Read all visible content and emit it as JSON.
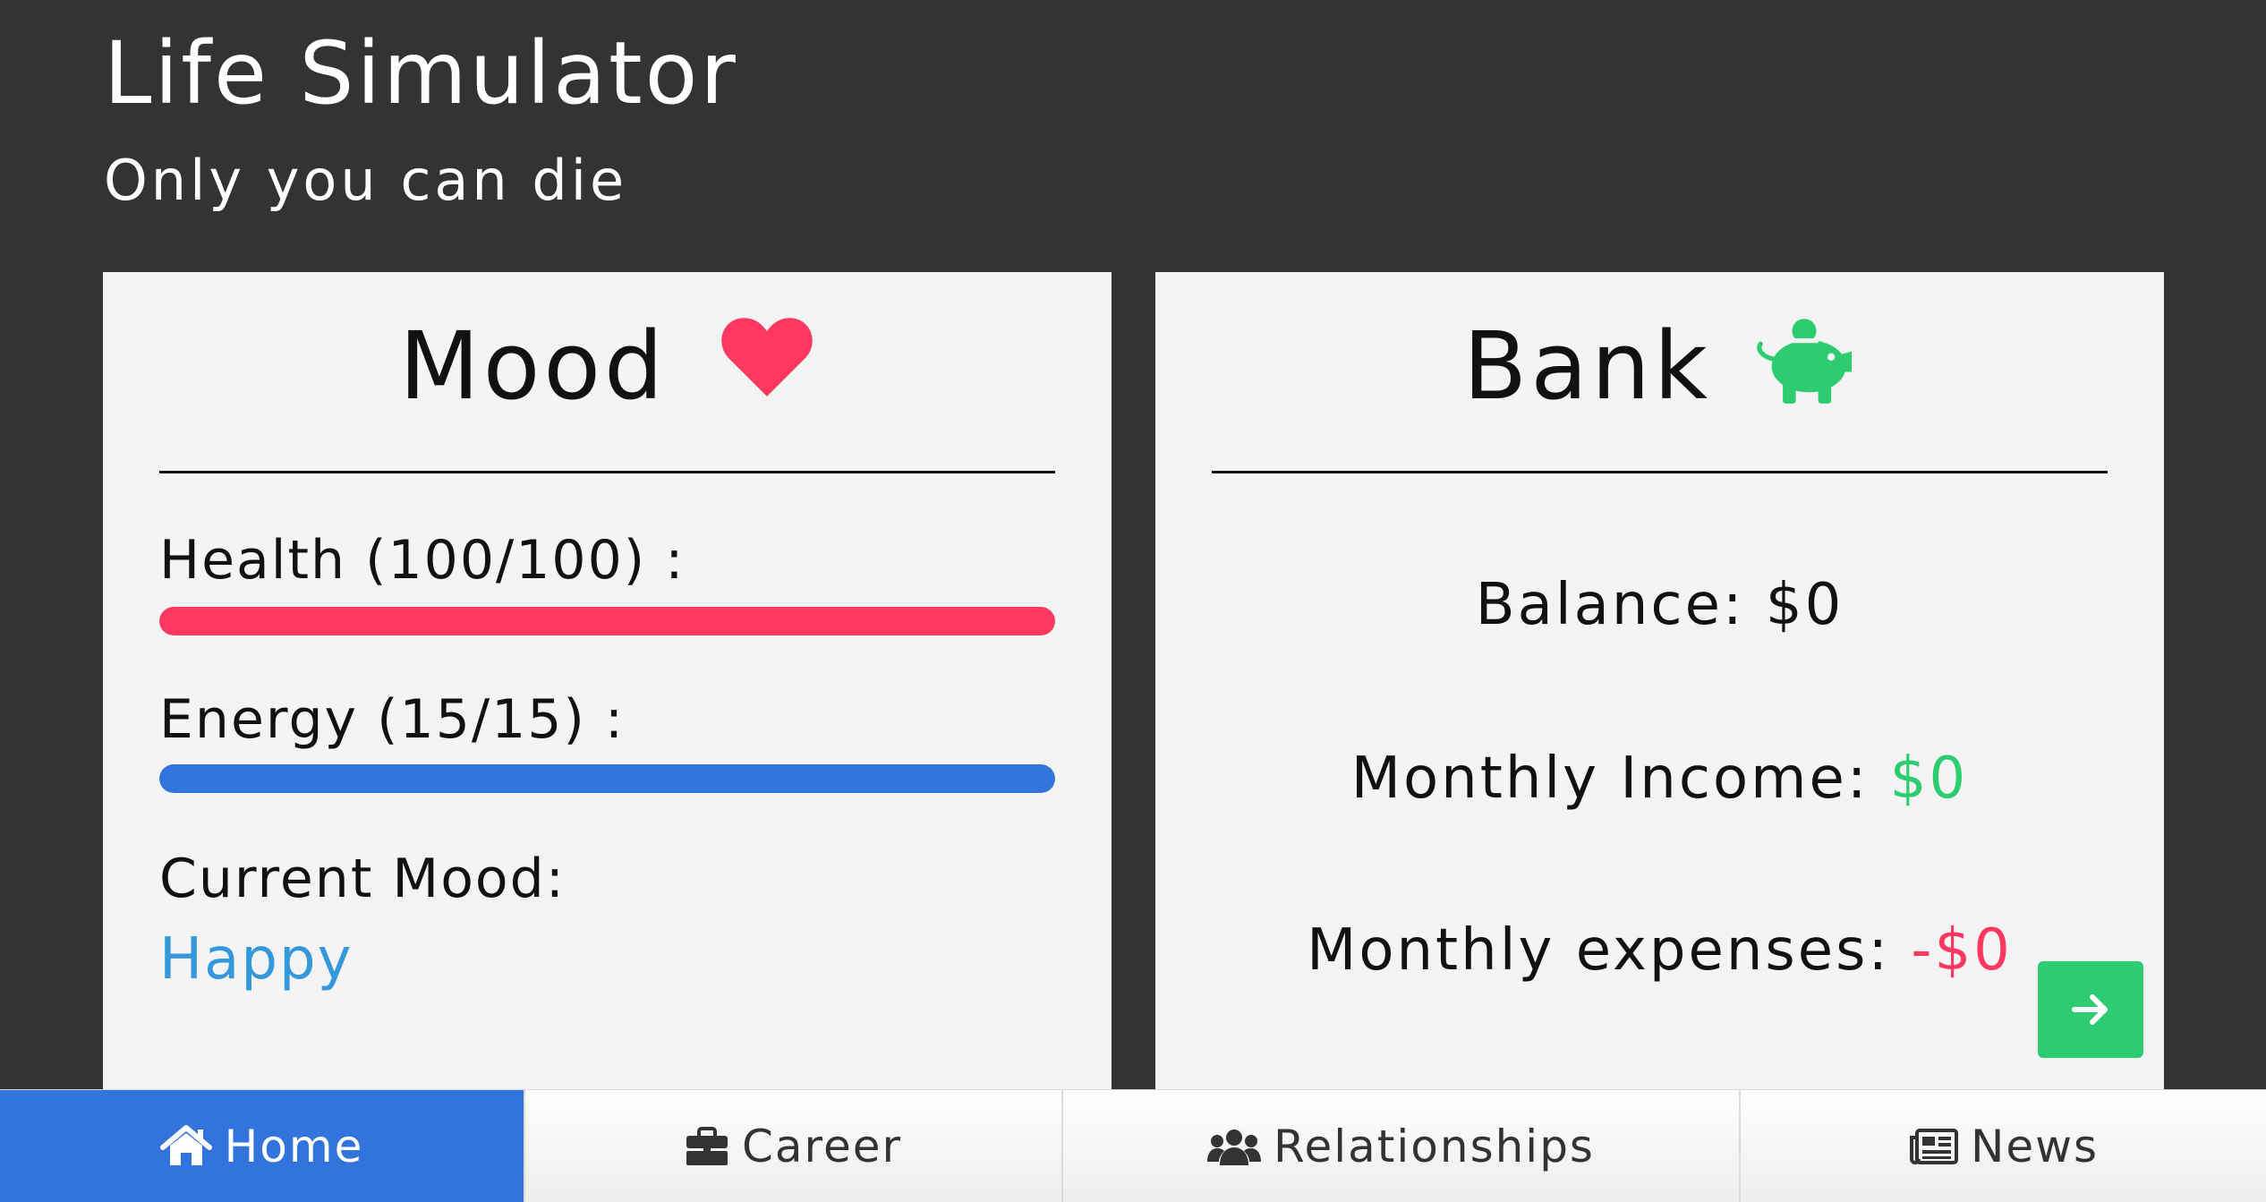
{
  "header": {
    "title": "Life Simulator",
    "subtitle": "Only you can die"
  },
  "mood_card": {
    "title": "Mood",
    "icon": "heart-icon",
    "health_label": "Health (100/100) :",
    "health_value": 100,
    "health_max": 100,
    "health_color": "#ff3860",
    "energy_label": "Energy (15/15) :",
    "energy_value": 15,
    "energy_max": 15,
    "energy_color": "#3273dc",
    "current_mood_label": "Current Mood:",
    "current_mood_value": "Happy",
    "current_mood_color": "#3498db"
  },
  "bank_card": {
    "title": "Bank",
    "icon": "piggy-bank-icon",
    "balance_label": "Balance:",
    "balance_value": "$0",
    "income_label": "Monthly Income:",
    "income_value": "$0",
    "income_color": "#2ecc71",
    "expenses_label": "Monthly expenses:",
    "expenses_value": "-$0",
    "expenses_color": "#ff3860",
    "next_button_icon": "arrow-right-icon"
  },
  "nav": {
    "items": [
      {
        "label": "Home",
        "icon": "home-icon",
        "active": true
      },
      {
        "label": "Career",
        "icon": "briefcase-icon",
        "active": false
      },
      {
        "label": "Relationships",
        "icon": "users-icon",
        "active": false
      },
      {
        "label": "News",
        "icon": "newspaper-icon",
        "active": false
      }
    ]
  },
  "colors": {
    "background": "#333333",
    "card": "#f4f4f4",
    "accent_green": "#2ecc71",
    "accent_red": "#ff3860",
    "accent_blue": "#3273dc"
  }
}
